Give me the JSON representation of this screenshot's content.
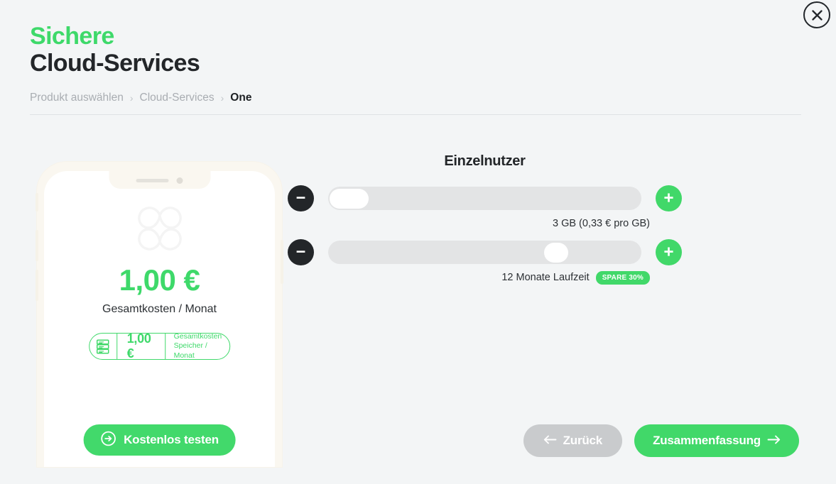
{
  "window": {
    "close_label": "×"
  },
  "header": {
    "title_line1": "Sichere",
    "title_line2": "Cloud-Services",
    "accent_color": "#3ed96a"
  },
  "breadcrumb": {
    "separator": "›",
    "items": [
      {
        "label": "Produkt auswählen",
        "active": false
      },
      {
        "label": "Cloud-Services",
        "active": false
      },
      {
        "label": "One",
        "active": true
      }
    ]
  },
  "phone_preview": {
    "price": "1,00 €",
    "price_caption": "Gesamtkosten / Monat",
    "storage_badge": {
      "icon": "server-storage-icon",
      "price": "1,00 €",
      "label_line1": "Gesamtkosten",
      "label_line2": "Speicher / Monat"
    },
    "trial_button": {
      "label": "Kostenlos testen",
      "icon": "arrow-right-circle-icon"
    },
    "frame_color": "#faf7f0",
    "screen_color": "#ffffff"
  },
  "configurator": {
    "title": "Einzelnutzer",
    "sliders": [
      {
        "name": "storage",
        "decrement_icon": "minus-icon",
        "increment_icon": "plus-icon",
        "handle_percent": 2,
        "handle_width": 55,
        "handle_shape": "pill",
        "caption": "3 GB (0,33 € pro GB)",
        "badge": null
      },
      {
        "name": "contract-term",
        "decrement_icon": "minus-icon",
        "increment_icon": "plus-icon",
        "handle_percent": 74,
        "handle_width": 34,
        "handle_shape": "circle",
        "caption": "12 Monate Laufzeit",
        "badge": "SPARE 30%"
      }
    ]
  },
  "footer": {
    "back_button": {
      "label": "Zurück",
      "icon": "arrow-left-icon"
    },
    "summary_button": {
      "label": "Zusammenfassung",
      "icon": "arrow-right-icon"
    }
  },
  "colors": {
    "background": "#f3f5f6",
    "green": "#41d869",
    "dark": "#232629",
    "gray": "#c9cbcd",
    "track": "#e3e4e5"
  }
}
